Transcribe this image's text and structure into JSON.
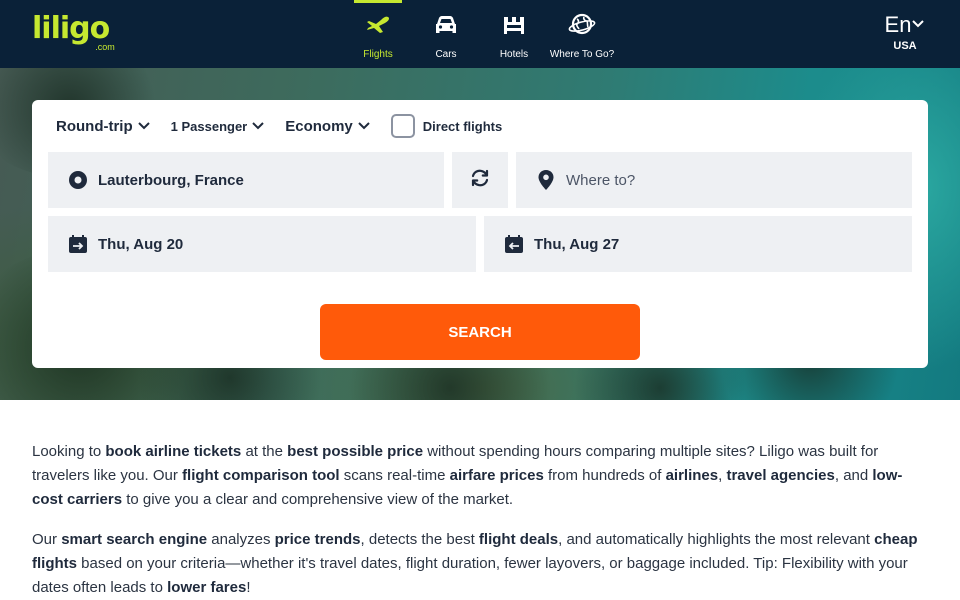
{
  "brand": {
    "logo_text": "liligo",
    "logo_suffix": ".com",
    "accent_color": "#c6e830",
    "header_bg": "#0a2138"
  },
  "nav": {
    "items": [
      {
        "label": "Flights",
        "icon": "airplane-icon",
        "active": true
      },
      {
        "label": "Cars",
        "icon": "car-icon",
        "active": false
      },
      {
        "label": "Hotels",
        "icon": "bed-icon",
        "active": false
      },
      {
        "label": "Where To Go?",
        "icon": "globe-icon",
        "active": false
      }
    ]
  },
  "language": {
    "code": "En",
    "country": "USA"
  },
  "search": {
    "trip_type": "Round-trip",
    "passengers": "1 Passenger",
    "cabin": "Economy",
    "direct_flights_label": "Direct flights",
    "direct_flights_checked": false,
    "origin_value": "Lauterbourg, France",
    "destination_placeholder": "Where to?",
    "depart_date": "Thu, Aug 20",
    "return_date": "Thu, Aug 27",
    "search_button": "SEARCH",
    "button_color": "#ff5a0a"
  },
  "content": {
    "paragraph_1": [
      {
        "t": "Looking to ",
        "b": false
      },
      {
        "t": "book airline tickets",
        "b": true
      },
      {
        "t": " at the ",
        "b": false
      },
      {
        "t": "best possible price",
        "b": true
      },
      {
        "t": " without spending hours comparing multiple sites? Liligo was built for travelers like you. Our ",
        "b": false
      },
      {
        "t": "flight comparison tool",
        "b": true
      },
      {
        "t": " scans real-time ",
        "b": false
      },
      {
        "t": "airfare prices",
        "b": true
      },
      {
        "t": " from hundreds of ",
        "b": false
      },
      {
        "t": "airlines",
        "b": true
      },
      {
        "t": ", ",
        "b": false
      },
      {
        "t": "travel agencies",
        "b": true
      },
      {
        "t": ", and ",
        "b": false
      },
      {
        "t": "low-cost carriers",
        "b": true
      },
      {
        "t": " to give you a clear and comprehensive view of the market.",
        "b": false
      }
    ],
    "paragraph_2": [
      {
        "t": "Our ",
        "b": false
      },
      {
        "t": "smart search engine",
        "b": true
      },
      {
        "t": " analyzes ",
        "b": false
      },
      {
        "t": "price trends",
        "b": true
      },
      {
        "t": ", detects the best ",
        "b": false
      },
      {
        "t": "flight deals",
        "b": true
      },
      {
        "t": ", and automatically highlights the most relevant ",
        "b": false
      },
      {
        "t": "cheap flights",
        "b": true
      },
      {
        "t": " based on your criteria—whether it's travel dates, flight duration, fewer layovers, or baggage included. Tip: Flexibility with your dates often leads to ",
        "b": false
      },
      {
        "t": "lower fares",
        "b": true
      },
      {
        "t": "!",
        "b": false
      }
    ]
  }
}
